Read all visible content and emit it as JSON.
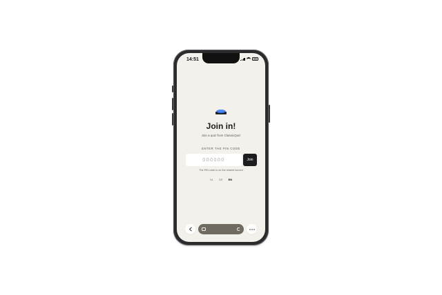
{
  "status_bar": {
    "time": "14:51"
  },
  "page": {
    "title": "Join in!",
    "subtitle": "Join a quiz from ClassicQuiz",
    "pin_label": "ENTER THE PIN CODE",
    "pin_placeholder": "000000",
    "join_label": "Join",
    "hint": "The PIN code is on the shared screen",
    "languages": [
      {
        "code": "NL",
        "active": false
      },
      {
        "code": "DE",
        "active": false
      },
      {
        "code": "EN",
        "active": true
      }
    ]
  },
  "browser_bar": {
    "back_icon": "chevron-left-icon",
    "tabs_icon": "tabs-icon",
    "reload_icon": "reload-icon",
    "more_icon": "ellipsis-icon"
  },
  "colors": {
    "background": "#f3f1ec",
    "accent": "#1d1d1f",
    "logo_blue": "#2f6fe4",
    "url_bar": "#6f6b61"
  }
}
